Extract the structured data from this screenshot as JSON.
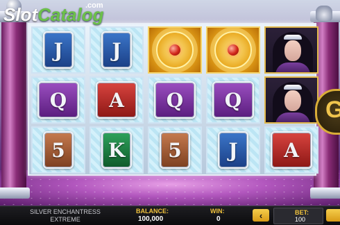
{
  "logo": {
    "slot": "Slot",
    "catalog": "Catalog",
    "dotcom": ".com"
  },
  "reels": [
    [
      {
        "type": "card",
        "text": "J",
        "color": "blue"
      },
      {
        "type": "card",
        "text": "J",
        "color": "blue"
      },
      {
        "type": "amulet"
      },
      {
        "type": "amulet"
      },
      {
        "type": "enchantress"
      }
    ],
    [
      {
        "type": "card",
        "text": "Q",
        "color": "purple"
      },
      {
        "type": "card",
        "text": "A",
        "color": "red"
      },
      {
        "type": "card",
        "text": "Q",
        "color": "purple"
      },
      {
        "type": "card",
        "text": "Q",
        "color": "purple"
      },
      {
        "type": "enchantress"
      }
    ],
    [
      {
        "type": "card",
        "text": "5",
        "color": "brown"
      },
      {
        "type": "card",
        "text": "K",
        "color": "green"
      },
      {
        "type": "card",
        "text": "5",
        "color": "brown"
      },
      {
        "type": "card",
        "text": "J",
        "color": "blue"
      },
      {
        "type": "card",
        "text": "A",
        "color": "red"
      }
    ]
  ],
  "spin_button_glyph": "G",
  "bottom_bar": {
    "game_title_line1": "SILVER ENCHANTRESS",
    "game_title_line2": "EXTREME",
    "balance_label": "BALANCE:",
    "balance_value": "100,000",
    "win_label": "WIN:",
    "win_value": "0",
    "prev_bet_glyph": "‹",
    "bet_label": "BET:",
    "bet_value": "100"
  },
  "icons": [
    "pillar-left",
    "pillar-right",
    "gargoyle-icon",
    "amulet-symbol",
    "enchantress-symbol"
  ]
}
